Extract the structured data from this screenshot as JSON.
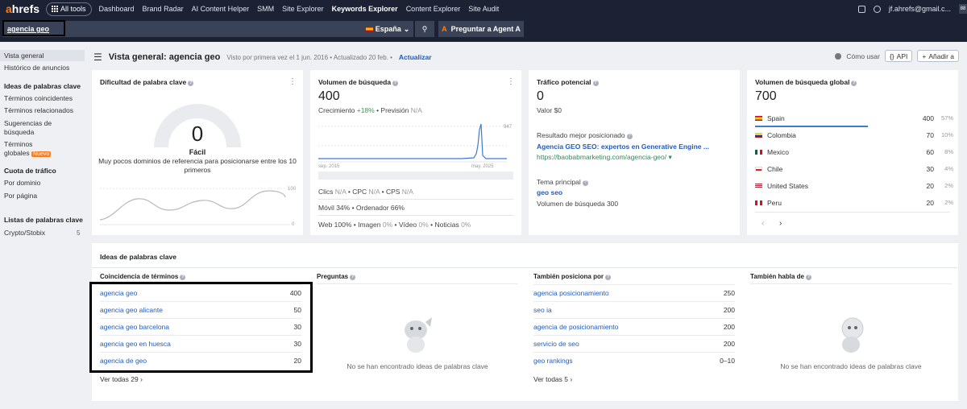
{
  "nav": {
    "logo_a": "a",
    "logo_rest": "hrefs",
    "all_tools": "All tools",
    "links": [
      "Dashboard",
      "Brand Radar",
      "AI Content Helper",
      "SMM",
      "Site Explorer",
      "Keywords Explorer",
      "Content Explorer",
      "Site Audit"
    ],
    "active": "Keywords Explorer",
    "user": "jf.ahrefs@gmail.c...",
    "badge": "88"
  },
  "search": {
    "query": "agencia geo",
    "country": "España",
    "agent_button": "Preguntar a Agent A",
    "agent_icon": "A"
  },
  "sidebar": {
    "items": [
      {
        "label": "Vista general"
      },
      {
        "label": "Histórico de anuncios"
      },
      {
        "label": "Ideas de palabras clave"
      },
      {
        "label": "Términos coincidentes"
      },
      {
        "label": "Términos relacionados"
      },
      {
        "label": "Sugerencias de búsqueda"
      },
      {
        "label": "Términos globales"
      },
      {
        "label": "Cuota de tráfico"
      },
      {
        "label": "Por dominio"
      },
      {
        "label": "Por página"
      },
      {
        "label": "Listas de palabras clave"
      },
      {
        "label": "Crypto/Stobix",
        "count": "5"
      }
    ],
    "new_badge": "Nuevo"
  },
  "header": {
    "title": "Vista general: agencia geo",
    "meta": "Visto por primera vez el 1 jun. 2016 • Actualizado 20 feb. •",
    "update": "Actualizar",
    "como_usar": "Cómo usar",
    "api": "API",
    "add": "Añadir a"
  },
  "kd": {
    "title": "Dificultad de palabra clave",
    "value": "0",
    "label": "Fácil",
    "desc": "Muy pocos dominios de referencia para posicionarse entre los 10 primeros",
    "axis_max": "100",
    "axis_min": "0"
  },
  "volume": {
    "title": "Volumen de búsqueda",
    "value": "400",
    "growth_label": "Crecimiento",
    "growth": "+18%",
    "forecast_label": "Previsión",
    "forecast": "N/A",
    "y_max": "947",
    "x_start": "sep. 2015",
    "x_end": "may. 2025",
    "clicks_label": "Clics",
    "clicks": "N/A",
    "cpc_label": "CPC",
    "cpc": "N/A",
    "cps_label": "CPS",
    "cps": "N/A",
    "mobile": "Móvil 34%",
    "desktop": "Ordenador 66%",
    "web": "Web 100%",
    "image_label": "Imagen",
    "image": "0%",
    "video_label": "Vídeo",
    "video": "0%",
    "news_label": "Noticias",
    "news": "0%"
  },
  "traffic": {
    "title": "Tráfico potencial",
    "value": "0",
    "valor": "Valor $0",
    "best_label": "Resultado mejor posicionado",
    "best_title": "Agencia GEO SEO: expertos en Generative Engine ...",
    "best_url": "https://baobabmarketing.com/agencia-geo/",
    "topic_label": "Tema principal",
    "topic": "geo seo",
    "topic_volume": "Volumen de búsqueda 300"
  },
  "global": {
    "title": "Volumen de búsqueda global",
    "value": "700",
    "countries": [
      {
        "name": "Spain",
        "value": "400",
        "pct": "57%"
      },
      {
        "name": "Colombia",
        "value": "70",
        "pct": "10%"
      },
      {
        "name": "Mexico",
        "value": "60",
        "pct": "8%"
      },
      {
        "name": "Chile",
        "value": "30",
        "pct": "4%"
      },
      {
        "name": "United States",
        "value": "20",
        "pct": "2%"
      },
      {
        "name": "Peru",
        "value": "20",
        "pct": "2%"
      }
    ]
  },
  "ideas": {
    "title": "Ideas de palabras clave",
    "matching": {
      "title": "Coincidencia de términos",
      "rows": [
        {
          "kw": "agencia geo",
          "v": "400"
        },
        {
          "kw": "agencia geo alicante",
          "v": "50"
        },
        {
          "kw": "agencia geo barcelona",
          "v": "30"
        },
        {
          "kw": "agencia geo en huesca",
          "v": "30"
        },
        {
          "kw": "agencia de geo",
          "v": "20"
        }
      ],
      "view_all": "Ver todas 29"
    },
    "questions": {
      "title": "Preguntas",
      "empty": "No se han encontrado ideas de palabras clave"
    },
    "also_rank": {
      "title": "También posiciona por",
      "rows": [
        {
          "kw": "agencia posicionamiento",
          "v": "250"
        },
        {
          "kw": "seo ia",
          "v": "200"
        },
        {
          "kw": "agencia de posicionamiento",
          "v": "200"
        },
        {
          "kw": "servicio de seo",
          "v": "200"
        },
        {
          "kw": "geo rankings",
          "v": "0–10"
        }
      ],
      "view_all": "Ver todas 5"
    },
    "also_talk": {
      "title": "También habla de",
      "empty": "No se han encontrado ideas de palabras clave"
    }
  }
}
